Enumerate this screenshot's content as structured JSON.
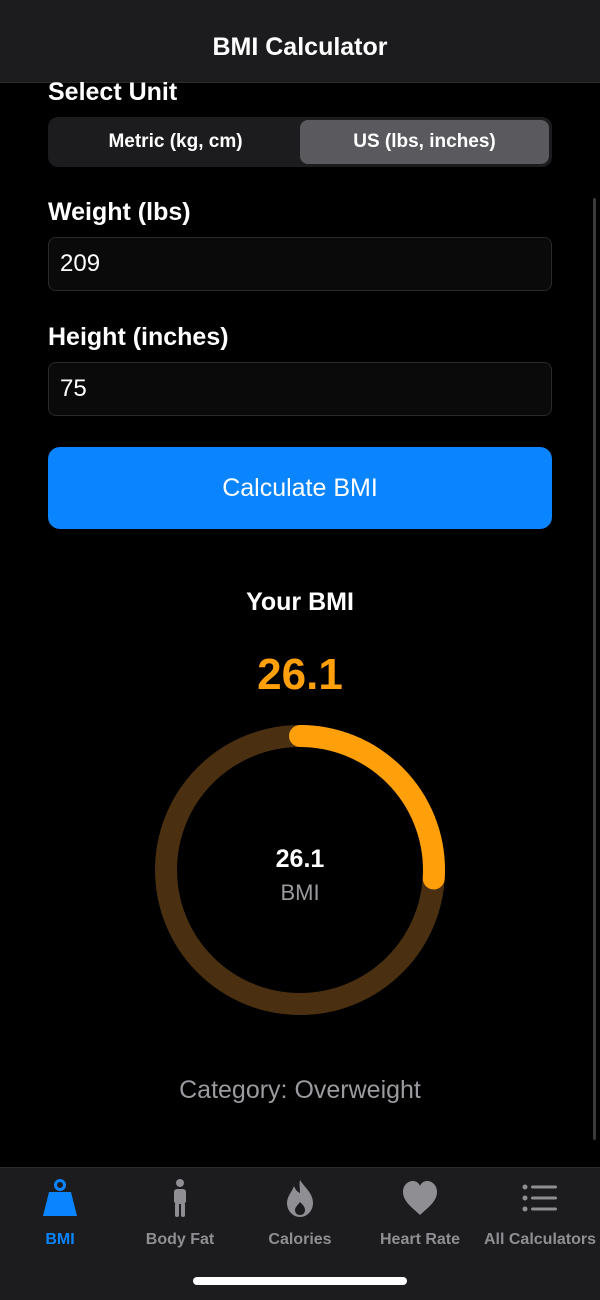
{
  "header": {
    "title": "BMI Calculator"
  },
  "unit": {
    "label": "Select Unit",
    "options": [
      "Metric (kg, cm)",
      "US (lbs, inches)"
    ],
    "selected": "US (lbs, inches)"
  },
  "weight": {
    "label": "Weight (lbs)",
    "value": "209"
  },
  "height": {
    "label": "Height (inches)",
    "value": "75"
  },
  "calculate_label": "Calculate BMI",
  "result": {
    "title": "Your BMI",
    "value": "26.1",
    "gauge_value": "26.1",
    "gauge_unit": "BMI",
    "gauge_fraction": 0.26,
    "category": "Category: Overweight"
  },
  "colors": {
    "accent": "#0a84ff",
    "result": "#ff9f0a",
    "gauge_track": "#4a3010"
  },
  "tabs": [
    {
      "label": "BMI",
      "icon": "weight-icon",
      "active": true
    },
    {
      "label": "Body Fat",
      "icon": "person-icon",
      "active": false
    },
    {
      "label": "Calories",
      "icon": "flame-icon",
      "active": false
    },
    {
      "label": "Heart Rate",
      "icon": "heart-icon",
      "active": false
    },
    {
      "label": "All Calculators",
      "icon": "list-icon",
      "active": false
    }
  ]
}
